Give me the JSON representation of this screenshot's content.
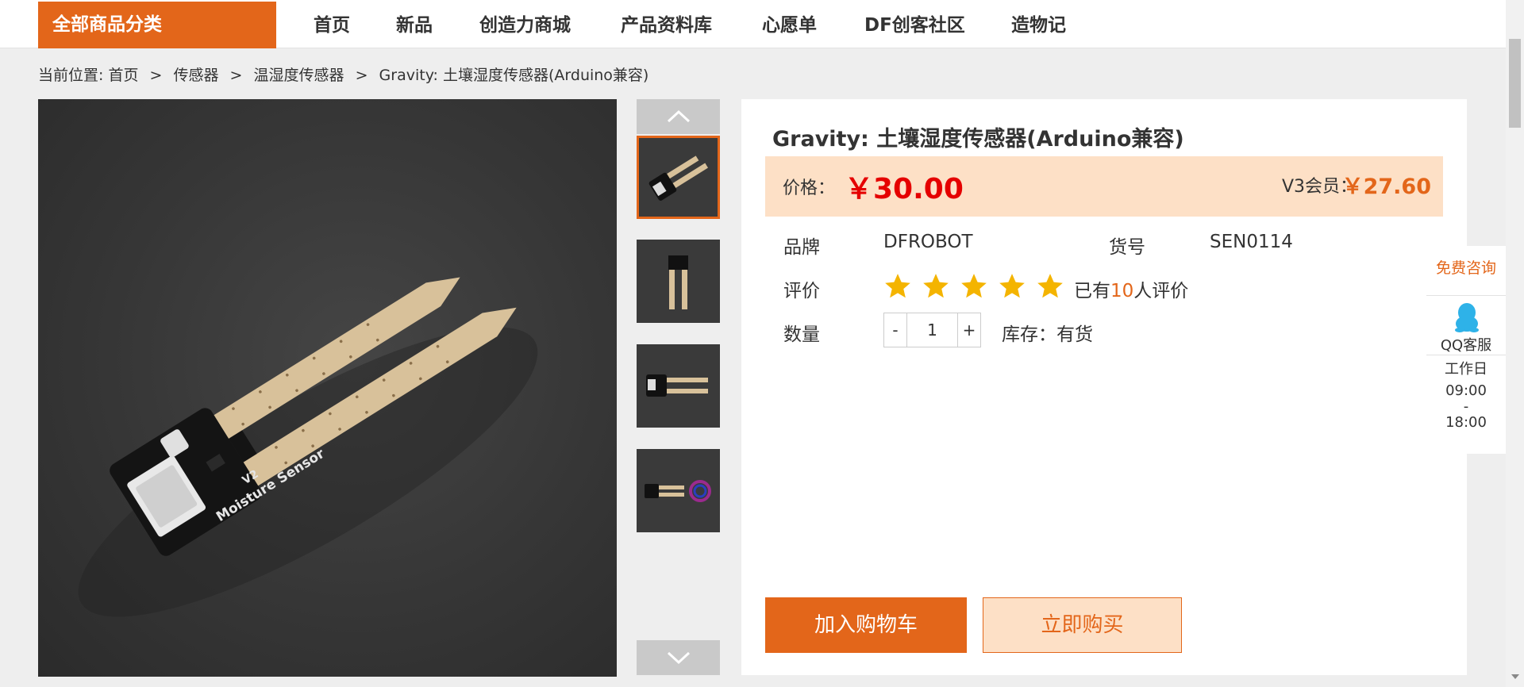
{
  "nav": {
    "all_categories": "全部商品分类",
    "items": [
      "首页",
      "新品",
      "创造力商城",
      "产品资料库",
      "心愿单",
      "DF创客社区",
      "造物记"
    ]
  },
  "breadcrumb": {
    "prefix": "当前位置:",
    "items": [
      "首页",
      "传感器",
      "温湿度传感器",
      "Gravity: 土壤湿度传感器(Arduino兼容)"
    ],
    "separator": ">"
  },
  "gallery": {
    "main_image": "moisture-sensor-photo",
    "thumbnails": [
      "thumb-angled",
      "thumb-vertical",
      "thumb-side",
      "thumb-with-cable"
    ],
    "active_thumbnail": 0
  },
  "product": {
    "title": "Gravity: 土壤湿度传感器(Arduino兼容)",
    "price_label": "价格：",
    "price": "￥30.00",
    "member_label": "V3会员：",
    "member_price": "￥27.60",
    "brand_label": "品牌",
    "brand": "DFROBOT",
    "sku_label": "货号",
    "sku": "SEN0114",
    "rating_label": "评价",
    "rating": 5,
    "review_prefix": "已有",
    "review_count": "10",
    "review_suffix": "人评价",
    "qty_label": "数量",
    "qty_minus": "-",
    "qty_value": "1",
    "qty_plus": "+",
    "stock": "库存：有货",
    "add_to_cart": "加入购物车",
    "buy_now": "立即购买"
  },
  "consult": {
    "title": "免费咨询",
    "qq_label": "QQ客服",
    "hours_label": "工作日",
    "hours_start": "09:00",
    "hours_sep": "-",
    "hours_end": "18:00"
  },
  "colors": {
    "accent": "#e3661a",
    "price": "#e50000",
    "price_bg": "#fde0c6",
    "star": "#f4b400"
  }
}
